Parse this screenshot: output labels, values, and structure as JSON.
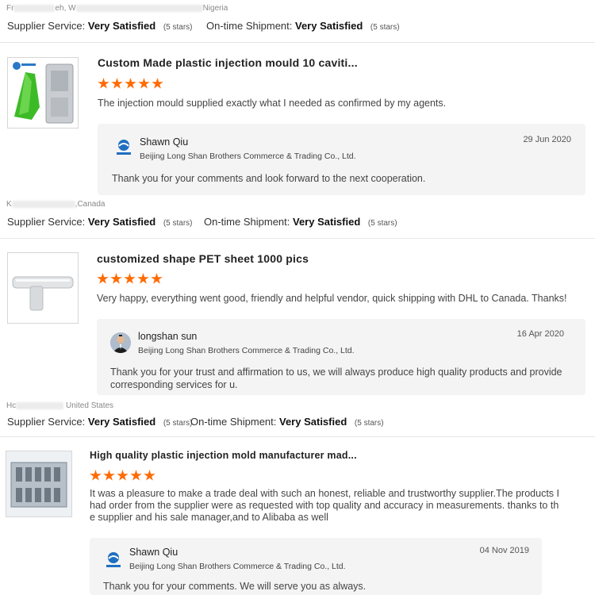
{
  "labels": {
    "supplier_service": "Supplier Service:",
    "ontime_shipment": "On-time Shipment:",
    "very_satisfied": "Very Satisfied",
    "five_stars": "(5 stars)"
  },
  "colors": {
    "star": "#ff6a00",
    "reply_bg": "#f4f4f4",
    "divider": "#e6e6e6"
  },
  "reviews": [
    {
      "reviewer_prefix": "Fr",
      "reviewer_mid": "eh, W",
      "country": "Nigeria",
      "product_title": "Custom Made plastic injection mould 10 caviti...",
      "product_icon": "green-mould-thumbnail",
      "rating": 5,
      "text": "The injection mould supplied exactly what I needed as confirmed by my agents.",
      "reply": {
        "name": "Shawn Qiu",
        "company": "Beijing Long Shan Brothers Commerce & Trading Co., Ltd.",
        "date": "29 Jun 2020",
        "text": "Thank you for your comments and look forward to the next cooperation.",
        "avatar": "company-logo-icon"
      }
    },
    {
      "reviewer_prefix": "K",
      "country": ",Canada",
      "product_title": "customized shape PET sheet 1000 pics",
      "product_icon": "clear-tee-part-thumbnail",
      "rating": 5,
      "text": "Very happy, everything went good, friendly and helpful vendor, quick shipping with DHL to Canada. Thanks!",
      "reply": {
        "name": "longshan sun",
        "company": "Beijing Long Shan Brothers Commerce & Trading Co., Ltd.",
        "date": "16 Apr 2020",
        "text_line1": "Thank you for your trust and affirmation to us, we will always produce high quality products and provide",
        "text_line2": "corresponding services for u.",
        "avatar": "person-avatar"
      }
    },
    {
      "reviewer_prefix": "Hc",
      "country": "United States",
      "product_title": "High quality plastic injection mold manufacturer mad...",
      "product_icon": "multi-cavity-mold-thumbnail",
      "rating": 5,
      "text_line1": "It was a pleasure to make a trade deal with such an honest, reliable and trustworthy supplier.The products I",
      "text_line2": "had order from the supplier were as requested with top quality and accuracy in measurements. thanks to th",
      "text_line3": "e supplier and his sale manager,and to Alibaba as well",
      "reply": {
        "name": "Shawn Qiu",
        "company": "Beijing Long Shan Brothers Commerce & Trading Co., Ltd.",
        "date": "04 Nov 2019",
        "text": "Thank you for your comments. We will serve you as always.",
        "avatar": "company-logo-icon"
      }
    }
  ]
}
